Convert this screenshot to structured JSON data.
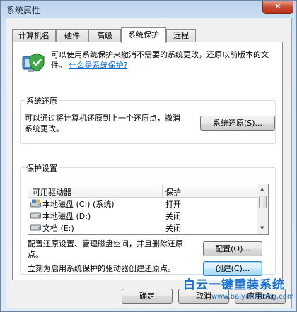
{
  "window": {
    "title": "系统属性",
    "close_label": "✕"
  },
  "tabs": [
    {
      "label": "计算机名"
    },
    {
      "label": "硬件"
    },
    {
      "label": "高级"
    },
    {
      "label": "系统保护",
      "active": true
    },
    {
      "label": "远程"
    }
  ],
  "intro": {
    "text": "可以使用系统保护来撤消不需要的系统更改，还原以前版本的文件。",
    "link": "什么是系统保护?"
  },
  "restore": {
    "group_label": "系统还原",
    "description": "可以通过将计算机还原到上一个还原点，撤消系统更改。",
    "button_label": "系统还原(S)..."
  },
  "protection": {
    "group_label": "保护设置",
    "columns": [
      "可用驱动器",
      "保护"
    ],
    "drives": [
      {
        "name": "本地磁盘 (C:) (系统)",
        "protection": "打开",
        "icon": "system-drive-icon"
      },
      {
        "name": "本地磁盘 (D:)",
        "protection": "关闭",
        "icon": "drive-icon"
      },
      {
        "name": "文档 (E:)",
        "protection": "关闭",
        "icon": "drive-icon"
      }
    ],
    "configure_text": "配置还原设置、管理磁盘空间，并且删除还原点。",
    "configure_button": "配置(O)...",
    "create_text": "立刻为启用系统保护的驱动器创建还原点。",
    "create_button": "创建(C)..."
  },
  "footer": {
    "ok_label": "确定",
    "cancel_label": "取消",
    "apply_label": "应用(A)"
  },
  "watermark": {
    "title": "白云一键重装系统",
    "url": "www.baiyunxitong.com"
  },
  "colors": {
    "link": "#0066cc",
    "close_button": "#c74a33",
    "watermark": "#1a73c9"
  }
}
